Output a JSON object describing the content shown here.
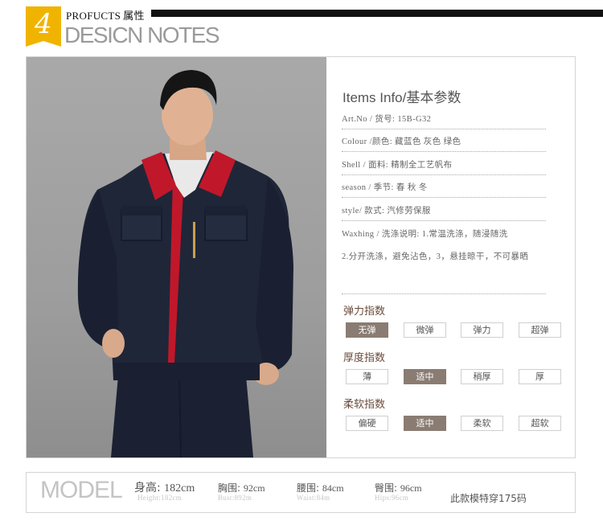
{
  "header": {
    "badge_number": "4",
    "products": "PROFUCTS",
    "products_cn": "属性",
    "design_notes": "DESICN NOTES"
  },
  "info": {
    "title": "Items Info/基本参数",
    "rows": [
      "Art.No / 货号: 15B-G32",
      "Colour /颜色: 藏蓝色 灰色 绿色",
      "Shell / 面料: 精制全工艺帆布",
      "season / 季节: 春 秋 冬",
      "style/ 款式: 汽修劳保服",
      "Waxhing / 洗涤说明: 1.常温洗涤，随浸随洗",
      "2.分开洗涤，避免沾色，3，悬挂晾干，不可暴晒"
    ]
  },
  "indices": [
    {
      "title": "弹力指数",
      "options": [
        "无弹",
        "微弹",
        "弹力",
        "超弹"
      ],
      "selected": 0
    },
    {
      "title": "厚度指数",
      "options": [
        "薄",
        "适中",
        "稍厚",
        "厚"
      ],
      "selected": 1
    },
    {
      "title": "柔软指数",
      "options": [
        "偏硬",
        "适中",
        "柔软",
        "超软"
      ],
      "selected": 1
    }
  ],
  "model": {
    "word": "MODEL",
    "height": {
      "label": "身高:",
      "value": "182cm",
      "sub": "Height:182cm"
    },
    "chest": {
      "label": "胸围:",
      "value": "92cm",
      "sub": "Bust:892m"
    },
    "waist": {
      "label": "腰围:",
      "value": "84cm",
      "sub": "Waist:84m"
    },
    "hips": {
      "label": "臀围:",
      "value": "96cm",
      "sub": "Hips:96cm"
    },
    "wearing": "此款模特穿175码"
  },
  "colors": {
    "badge": "#f0b400",
    "chip_selected": "#8a7c72",
    "jacket": "#1e2536",
    "collar_red": "#c0182a"
  }
}
